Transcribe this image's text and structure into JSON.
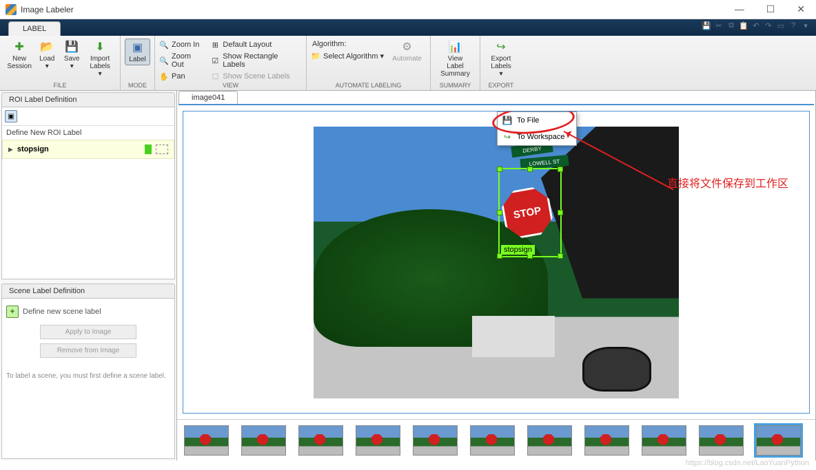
{
  "window": {
    "title": "Image Labeler"
  },
  "tab": {
    "label": "LABEL"
  },
  "ribbon": {
    "file": {
      "new": "New\nSession",
      "load": "Load\n▾",
      "save": "Save\n▾",
      "import": "Import\nLabels ▾",
      "group": "FILE"
    },
    "mode": {
      "label": "Label",
      "group": "MODE"
    },
    "view": {
      "zoomin": "Zoom In",
      "zoomout": "Zoom Out",
      "pan": "Pan",
      "layout": "Default Layout",
      "rect": "Show Rectangle Labels",
      "scene": "Show Scene Labels",
      "group": "VIEW"
    },
    "automate": {
      "algo_label": "Algorithm:",
      "select": "Select Algorithm  ▾",
      "automate": "Automate",
      "group": "AUTOMATE LABELING"
    },
    "summary": {
      "view": "View Label\nSummary",
      "group": "SUMMARY"
    },
    "export": {
      "export": "Export\nLabels ▾",
      "group": "EXPORT"
    }
  },
  "roi": {
    "title": "ROI Label Definition",
    "define": "Define New ROI Label",
    "item": "stopsign"
  },
  "scene": {
    "title": "Scene Label Definition",
    "define": "Define new scene label",
    "apply": "Apply to Image",
    "remove": "Remove from Image",
    "help": "To label a scene, you must first define a scene label."
  },
  "imgtab": "image041",
  "roi_tag": "stopsign",
  "stop_text": "STOP",
  "street1": "DERBY",
  "street2": "LOWELL  ST",
  "dropdown": {
    "tofile": "To File",
    "toworkspace": "To Workspace"
  },
  "annotation": "直接将文件保存到工作区",
  "watermark": "https://blog.csdn.net/LaoYuanPython"
}
